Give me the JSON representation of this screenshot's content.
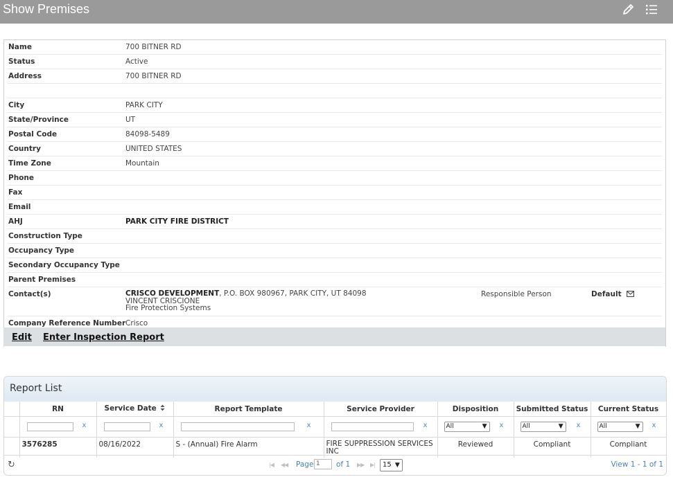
{
  "header": {
    "title": "Show Premises",
    "icons": [
      "pencil-icon",
      "list-icon"
    ]
  },
  "details": [
    {
      "label": "Name",
      "value": "700 BITNER RD"
    },
    {
      "label": "Status",
      "value": "Active"
    },
    {
      "label": "Address",
      "value": "700 BITNER RD"
    },
    {
      "label": "",
      "value": ""
    },
    {
      "label": "City",
      "value": "PARK CITY"
    },
    {
      "label": "State/Province",
      "value": "UT"
    },
    {
      "label": "Postal Code",
      "value": "84098-5489"
    },
    {
      "label": "Country",
      "value": "UNITED STATES"
    },
    {
      "label": "Time Zone",
      "value": "Mountain"
    },
    {
      "label": "Phone",
      "value": ""
    },
    {
      "label": "Fax",
      "value": ""
    },
    {
      "label": "Email",
      "value": ""
    },
    {
      "label": "AHJ",
      "value": "PARK CITY FIRE DISTRICT"
    },
    {
      "label": "Construction Type",
      "value": ""
    },
    {
      "label": "Occupancy Type",
      "value": ""
    },
    {
      "label": "Secondary Occupancy Type",
      "value": ""
    },
    {
      "label": "Parent Premises",
      "value": ""
    }
  ],
  "contact": {
    "label": "Contact(s)",
    "company": "CRISCO DEVELOPMENT",
    "address": ", P.O. BOX 980967, PARK CITY, UT 84098",
    "person": "VINCENT CRISCIONE",
    "category": "Fire Protection Systems",
    "relationship": "Responsible Person",
    "default_label": "Default"
  },
  "company_ref": {
    "label": "Company Reference Number",
    "value": "Crisco"
  },
  "actions": {
    "edit": "Edit",
    "inspection": "Enter Inspection Report"
  },
  "report_list": {
    "title": "Report List",
    "columns": [
      "RN",
      "Service Date",
      "Report Template",
      "Service Provider",
      "Disposition",
      "Submitted Status",
      "Current Status"
    ],
    "filter_select_value": "All",
    "clear_label": "x",
    "rows": [
      {
        "rn": "3576285",
        "service_date": "08/16/2022",
        "report_template": "S - (Annual) Fire Alarm",
        "service_provider": "FIRE SUPPRESSION SERVICES INC",
        "disposition": "Reviewed",
        "submitted_status": "Compliant",
        "current_status": "Compliant"
      }
    ],
    "pager": {
      "page_label": "Page",
      "page_value": "1",
      "of_label": "of 1",
      "rows_per_page": "15",
      "view_text": "View 1 - 1 of 1"
    }
  }
}
